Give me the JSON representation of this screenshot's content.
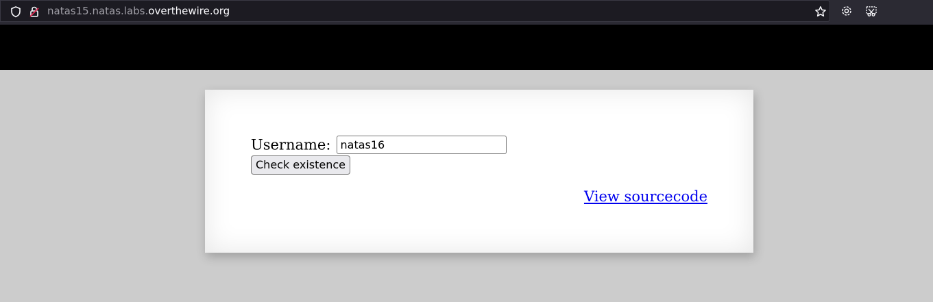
{
  "browser": {
    "url_prefix": "natas15.natas.labs.",
    "url_domain": "overthewire.org",
    "icons": [
      "shield-icon",
      "lock-icon",
      "bookmark-star-icon",
      "settings-gear-icon",
      "screenshot-icon"
    ]
  },
  "form": {
    "username_label": "Username:",
    "username_value": "natas16",
    "submit_label": "Check existence"
  },
  "links": {
    "view_source": "View sourcecode"
  },
  "colors": {
    "toolbar_bg": "#2b2a33",
    "header_bg": "#000000",
    "page_bg": "#cccccc",
    "link": "#0000ee"
  }
}
